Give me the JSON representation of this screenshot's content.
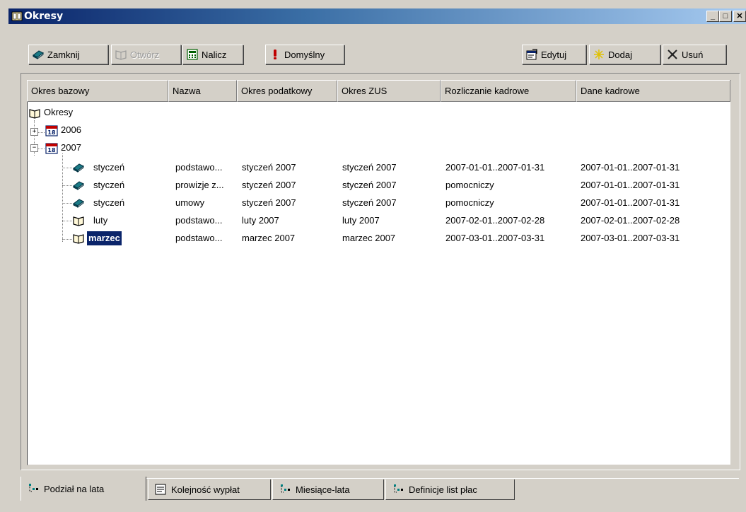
{
  "window": {
    "title": "Okresy",
    "controls": [
      "_",
      "□",
      "✕"
    ]
  },
  "toolbar": {
    "close_label": "Zamknij",
    "open_label": "Otwórz",
    "calculate_label": "Nalicz",
    "default_label": "Domyślny",
    "edit_label": "Edytuj",
    "add_label": "Dodaj",
    "delete_label": "Usuń"
  },
  "columns": [
    "Okres bazowy",
    "Nazwa",
    "Okres podatkowy",
    "Okres ZUS",
    "Rozliczanie kadrowe",
    "Dane kadrowe"
  ],
  "tree": {
    "root": "Okresy",
    "years": [
      "2006",
      "2007"
    ],
    "rows": [
      {
        "label": "styczeń",
        "nazwa": "podstawo...",
        "podatkowy": "styczeń 2007",
        "zus": "styczeń 2007",
        "rozliczanie": "2007-01-01..2007-01-31",
        "dane": "2007-01-01..2007-01-31"
      },
      {
        "label": "styczeń",
        "nazwa": "prowizje z...",
        "podatkowy": "styczeń 2007",
        "zus": "styczeń 2007",
        "rozliczanie": "pomocniczy",
        "dane": "2007-01-01..2007-01-31"
      },
      {
        "label": "styczeń",
        "nazwa": "umowy",
        "podatkowy": "styczeń 2007",
        "zus": "styczeń 2007",
        "rozliczanie": "pomocniczy",
        "dane": "2007-01-01..2007-01-31"
      },
      {
        "label": "luty",
        "nazwa": "podstawo...",
        "podatkowy": "luty 2007",
        "zus": "luty 2007",
        "rozliczanie": "2007-02-01..2007-02-28",
        "dane": "2007-02-01..2007-02-28"
      },
      {
        "label": "marzec",
        "nazwa": "podstawo...",
        "podatkowy": "marzec 2007",
        "zus": "marzec 2007",
        "rozliczanie": "2007-03-01..2007-03-31",
        "dane": "2007-03-01..2007-03-31"
      }
    ],
    "selected": "marzec"
  },
  "tabs": [
    "Podział na lata",
    "Kolejność wypłat",
    "Miesiące-lata",
    "Definicje list płac"
  ],
  "colors": {
    "title_start": "#0a246a",
    "title_end": "#a6caf0",
    "face": "#d4d0c8",
    "selection": "#0a246a"
  }
}
